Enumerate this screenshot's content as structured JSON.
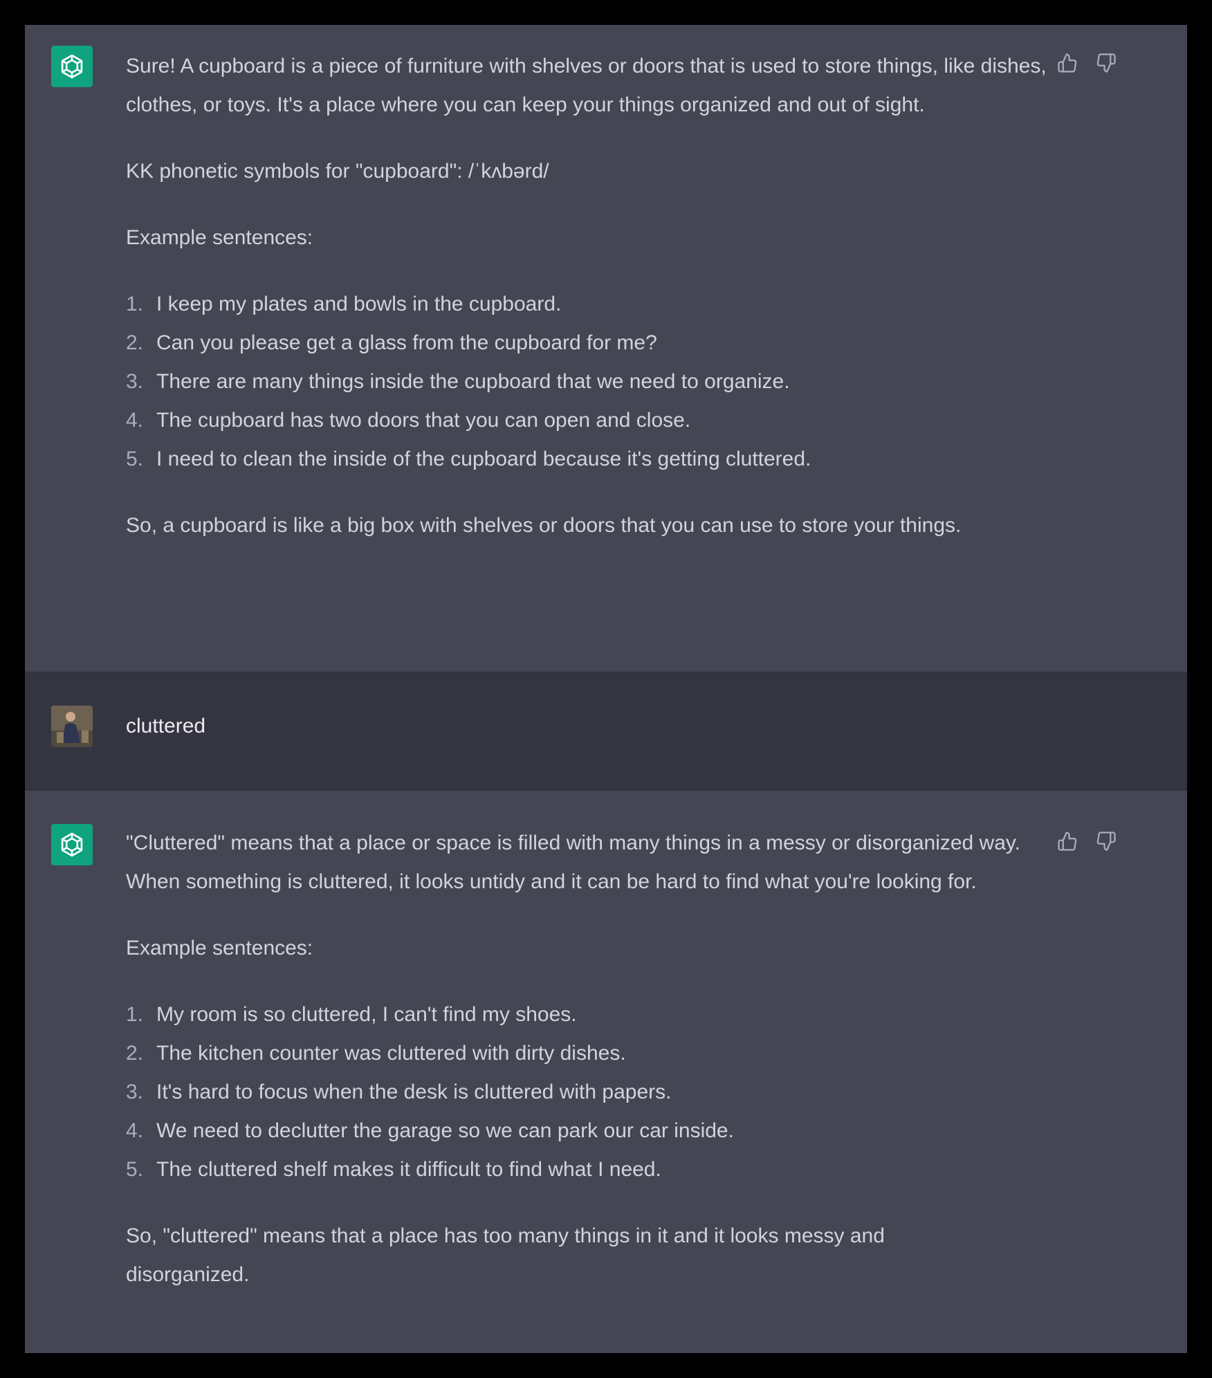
{
  "conversation": {
    "message1": {
      "paragraphs": [
        "Sure! A cupboard is a piece of furniture with shelves or doors that is used to store things, like dishes, clothes, or toys. It's a place where you can keep your things organized and out of sight.",
        "KK phonetic symbols for \"cupboard\": /ˈkʌbərd/",
        "Example sentences:"
      ],
      "examples": [
        {
          "num": "1.",
          "text": "I keep my plates and bowls in the cupboard."
        },
        {
          "num": "2.",
          "text": "Can you please get a glass from the cupboard for me?"
        },
        {
          "num": "3.",
          "text": "There are many things inside the cupboard that we need to organize."
        },
        {
          "num": "4.",
          "text": "The cupboard has two doors that you can open and close."
        },
        {
          "num": "5.",
          "text": "I need to clean the inside of the cupboard because it's getting cluttered."
        }
      ],
      "closing": "So, a cupboard is like a big box with shelves or doors that you can use to store your things."
    },
    "message2": {
      "text": "cluttered"
    },
    "message3": {
      "paragraphs": [
        "\"Cluttered\" means that a place or space is filled with many things in a messy or disorganized way. When something is cluttered, it looks untidy and it can be hard to find what you're looking for.",
        "Example sentences:"
      ],
      "examples": [
        {
          "num": "1.",
          "text": "My room is so cluttered, I can't find my shoes."
        },
        {
          "num": "2.",
          "text": "The kitchen counter was cluttered with dirty dishes."
        },
        {
          "num": "3.",
          "text": "It's hard to focus when the desk is cluttered with papers."
        },
        {
          "num": "4.",
          "text": "We need to declutter the garage so we can park our car inside."
        },
        {
          "num": "5.",
          "text": "The cluttered shelf makes it difficult to find what I need."
        }
      ],
      "closing": "So, \"cluttered\" means that a place has too many things in it and it looks messy and disorganized."
    }
  },
  "icons": {
    "assistant_avatar": "openai-logo-icon",
    "user_avatar": "user-photo",
    "like": "thumbs-up-icon",
    "dislike": "thumbs-down-icon"
  },
  "colors": {
    "assistant_bg": "#444654",
    "user_bg": "#343541",
    "avatar_green": "#10a37f",
    "text": "#d1d5db"
  }
}
